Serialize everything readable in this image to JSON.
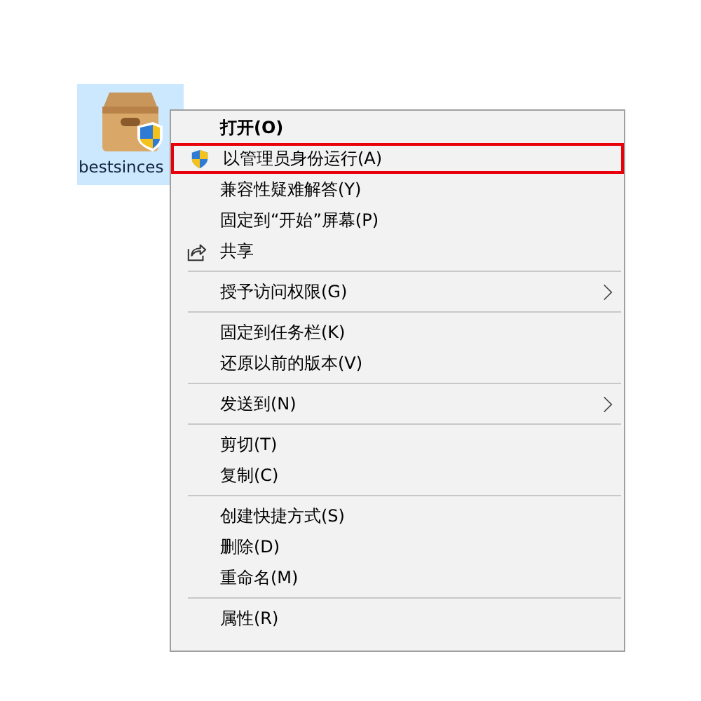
{
  "desktop_icon": {
    "label": "bestsinces",
    "selected": true
  },
  "context_menu": {
    "items": [
      {
        "kind": "item",
        "label": "打开(O)",
        "default": true
      },
      {
        "kind": "shield",
        "label": "以管理员身份运行(A)",
        "highlighted": true
      },
      {
        "kind": "item",
        "label": "兼容性疑难解答(Y)"
      },
      {
        "kind": "item",
        "label": "固定到“开始”屏幕(P)"
      },
      {
        "kind": "share",
        "label": "共享"
      },
      {
        "kind": "separator"
      },
      {
        "kind": "item",
        "label": "授予访问权限(G)",
        "submenu": true
      },
      {
        "kind": "separator"
      },
      {
        "kind": "item",
        "label": "固定到任务栏(K)"
      },
      {
        "kind": "item",
        "label": "还原以前的版本(V)"
      },
      {
        "kind": "separator"
      },
      {
        "kind": "item",
        "label": "发送到(N)",
        "submenu": true
      },
      {
        "kind": "separator"
      },
      {
        "kind": "item",
        "label": "剪切(T)"
      },
      {
        "kind": "item",
        "label": "复制(C)"
      },
      {
        "kind": "separator"
      },
      {
        "kind": "item",
        "label": "创建快捷方式(S)"
      },
      {
        "kind": "item",
        "label": "删除(D)"
      },
      {
        "kind": "item",
        "label": "重命名(M)"
      },
      {
        "kind": "separator"
      },
      {
        "kind": "item",
        "label": "属性(R)"
      }
    ]
  }
}
